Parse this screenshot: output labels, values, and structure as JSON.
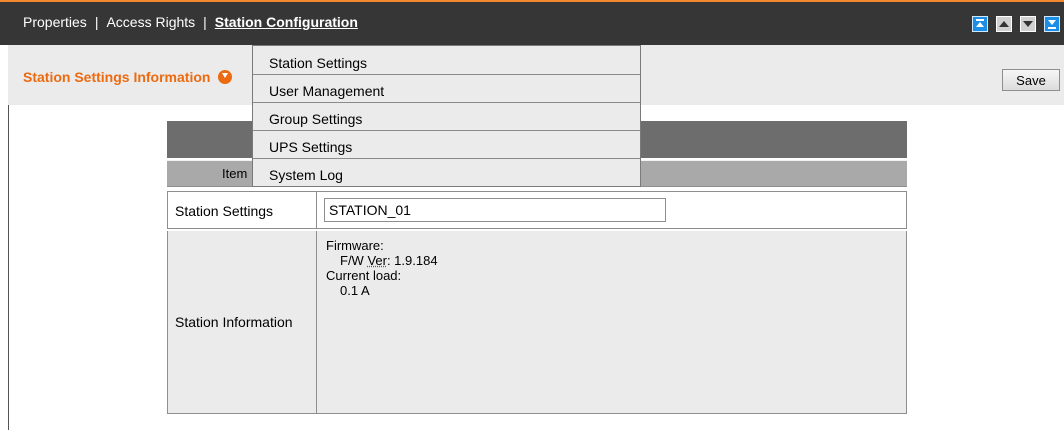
{
  "nav": {
    "properties": "Properties",
    "access_rights": "Access Rights",
    "station_configuration": "Station Configuration",
    "separator": "|"
  },
  "nav_buttons": [
    "scroll-top",
    "scroll-up",
    "scroll-down",
    "scroll-bottom"
  ],
  "subheader": {
    "title": "Station Settings Information",
    "save_label": "Save"
  },
  "dropdown": {
    "items": [
      "Station Settings",
      "User Management",
      "Group Settings",
      "UPS Settings",
      "System Log"
    ]
  },
  "table": {
    "header_item": "Item",
    "rows": {
      "station_settings": {
        "label": "Station Settings",
        "value": "STATION_01"
      },
      "station_information": {
        "label": "Station Information",
        "firmware_label": "Firmware:",
        "fw_ver_prefix": "F/W ",
        "fw_ver_word": "Ver",
        "fw_ver_value": ": 1.9.184",
        "current_load_label": "Current load:",
        "current_load_value": "0.1 A"
      }
    }
  },
  "colors": {
    "accent": "#ec6a10",
    "topbar": "#363636",
    "subbar": "#ebebeb",
    "nav_blue": "#1d8ee6"
  }
}
